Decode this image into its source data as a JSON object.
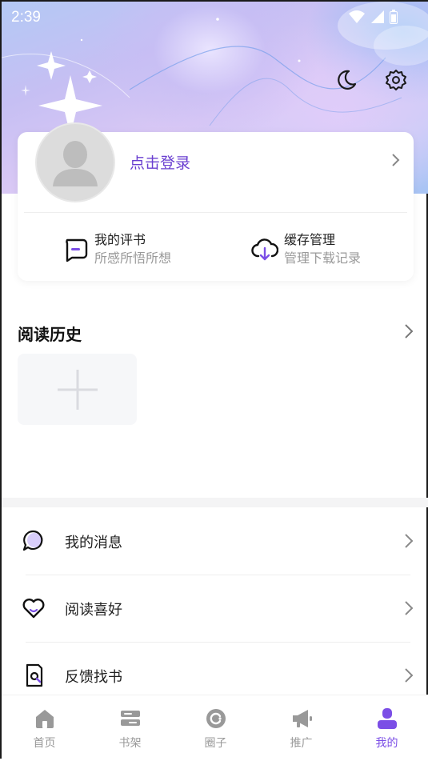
{
  "status_bar": {
    "time": "2:39"
  },
  "profile": {
    "login_label": "点击登录",
    "quick_actions": [
      {
        "title": "我的评书",
        "subtitle": "所感所悟所想",
        "icon": "comment-icon"
      },
      {
        "title": "缓存管理",
        "subtitle": "管理下载记录",
        "icon": "cloud-download-icon"
      }
    ]
  },
  "history": {
    "title": "阅读历史"
  },
  "menu": [
    {
      "label": "我的消息",
      "icon": "message-icon"
    },
    {
      "label": "阅读喜好",
      "icon": "heart-icon"
    },
    {
      "label": "反馈找书",
      "icon": "search-book-icon"
    }
  ],
  "tabs": [
    {
      "label": "首页",
      "icon": "home-icon",
      "active": false
    },
    {
      "label": "书架",
      "icon": "bookshelf-icon",
      "active": false
    },
    {
      "label": "圈子",
      "icon": "circle-icon",
      "active": false
    },
    {
      "label": "推广",
      "icon": "megaphone-icon",
      "active": false
    },
    {
      "label": "我的",
      "icon": "user-icon",
      "active": true
    }
  ],
  "colors": {
    "accent": "#7b4ee6",
    "login_text": "#6a3fd0",
    "tab_inactive": "#999999"
  }
}
